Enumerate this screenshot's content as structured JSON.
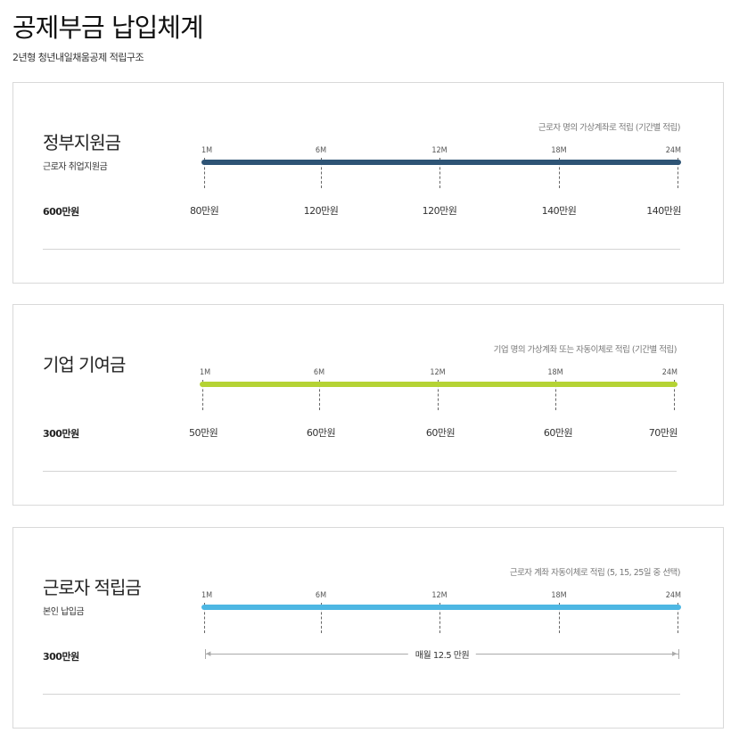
{
  "header": {
    "title": "공제부금 납입체계",
    "subtitle": "2년형 청년내일채움공제 적립구조"
  },
  "ticks": [
    "1M",
    "6M",
    "12M",
    "18M",
    "24M"
  ],
  "sections": [
    {
      "title": "정부지원금",
      "sub": "근로자 취업지원금",
      "total": "600만원",
      "note": "근로자 명의 가상계좌로 적립 (기간별 적립)",
      "bar_color": "#2e5475",
      "amounts": [
        "80만원",
        "120만원",
        "120만원",
        "140만원",
        "140만원"
      ]
    },
    {
      "title": "기업 기여금",
      "sub": "",
      "total": "300만원",
      "note": "기업 명의 가상계좌 또는 자동이체로 적립 (기간별 적립)",
      "bar_color": "#b5d334",
      "amounts": [
        "50만원",
        "60만원",
        "60만원",
        "60만원",
        "70만원"
      ]
    },
    {
      "title": "근로자 적립금",
      "sub": "본인 납입금",
      "total": "300만원",
      "note": "근로자 계좌 자동이체로 적립 (5, 15, 25일 중 선택)",
      "bar_color": "#4db7e3",
      "range_label": "매월 12.5 만원"
    }
  ]
}
